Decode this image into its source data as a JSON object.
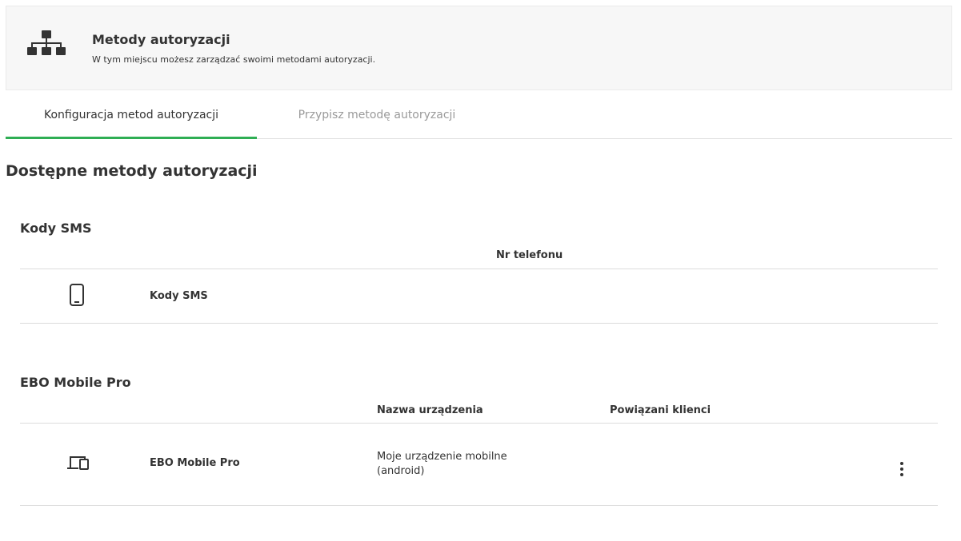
{
  "header": {
    "icon": "sitemap-icon",
    "title": "Metody autoryzacji",
    "subtitle": "W tym miejscu możesz zarządzać swoimi metodami autoryzacji."
  },
  "tabs": [
    {
      "label": "Konfiguracja metod autoryzacji",
      "active": true
    },
    {
      "label": "Przypisz metodę autoryzacji",
      "active": false
    }
  ],
  "section_title": "Dostępne metody autoryzacji",
  "sms": {
    "title": "Kody SMS",
    "columns": [
      "Nr telefonu"
    ],
    "rows": [
      {
        "icon": "smartphone-icon",
        "name": "Kody SMS",
        "phone": ""
      }
    ]
  },
  "ebo": {
    "title": "EBO Mobile Pro",
    "columns": [
      "Nazwa urządzenia",
      "Powiązani klienci"
    ],
    "rows": [
      {
        "icon": "devices-icon",
        "name": "EBO Mobile Pro",
        "device_line1": "Moje urządzenie mobilne",
        "device_line2": "(android)",
        "clients": "",
        "menu_icon": "more-vertical-icon"
      }
    ]
  },
  "colors": {
    "accent": "#2fae54",
    "text": "#333333",
    "muted": "#9a9a9a"
  }
}
